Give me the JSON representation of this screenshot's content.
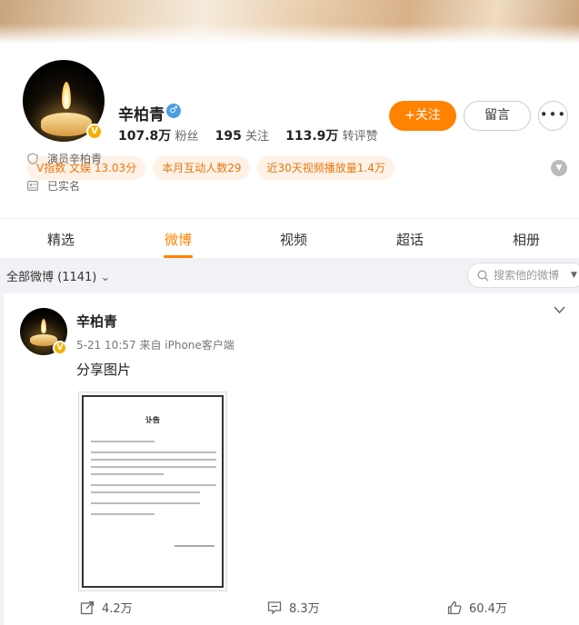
{
  "profile": {
    "name": "辛柏青",
    "gender_symbol": "♂",
    "verified_badge": "V",
    "stats": [
      {
        "value": "107.8万",
        "label": "粉丝"
      },
      {
        "value": "195",
        "label": "关注"
      },
      {
        "value": "113.9万",
        "label": "转评赞"
      }
    ],
    "follow_button": "+关注",
    "message_button": "留言",
    "more_button": "•••",
    "tags": [
      "V指数 文娱 13.03分",
      "本月互动人数29",
      "近30天视频播放量1.4万"
    ],
    "info": [
      {
        "icon": "shield-icon",
        "text": "演员辛柏青"
      },
      {
        "icon": "id-card-icon",
        "text": "已实名"
      }
    ]
  },
  "tabs": [
    "精选",
    "微博",
    "视频",
    "超话",
    "相册"
  ],
  "active_tab": "微博",
  "feed": {
    "filter_label": "全部微博 (1141)",
    "filter_caret": "⌄",
    "search_placeholder": "搜索他的微博"
  },
  "post": {
    "author": "辛柏青",
    "timestamp": "5-21 10:57",
    "source": "来自 iPhone客户端",
    "text": "分享图片",
    "image_title": "讣告",
    "reposts": "4.2万",
    "comments": "8.3万",
    "likes": "60.4万"
  },
  "colors": {
    "accent": "#ff8200",
    "tag_bg": "#fff1e6",
    "verified": "#f5b000",
    "gender": "#4a9fe3"
  }
}
